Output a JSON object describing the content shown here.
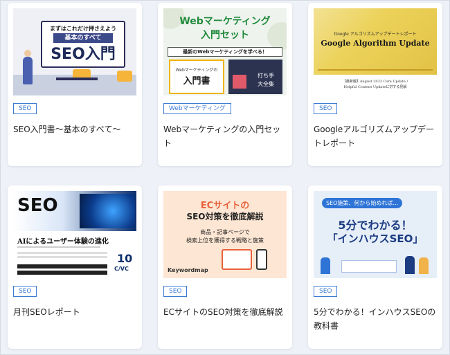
{
  "colors": {
    "tag_blue": "#3a7bd5",
    "page_bg": "#eef1f7",
    "card_bg": "#ffffff"
  },
  "cards": [
    {
      "tag": "SEO",
      "title": "SEO入門書〜基本のすべて〜",
      "thumb": {
        "line1": "まずはこれだけ押さえよう",
        "line2": "基本のすべて",
        "line3": "SEO入門"
      }
    },
    {
      "tag": "Webマーケティング",
      "title": "Webマーケティングの入門セット",
      "thumb": {
        "line1": "Webマーケティング",
        "line2": "入門セット",
        "line3": "最新のWebマーケティングを学べる！",
        "book_a": "入門書",
        "book_a_sub": "Webマーケティングの",
        "book_b": "打ち手",
        "book_b_sub": "大全集"
      }
    },
    {
      "tag": "SEO",
      "title": "Googleアルゴリズムアップデートレポート",
      "thumb": {
        "line1": "Google アルゴリズムアップデートレポート",
        "line2": "Google Algorithm Update",
        "line3": "【最新版】August 2023 Core Update /",
        "line4": "Helpful Content Updateに対する見解"
      }
    },
    {
      "tag": "SEO",
      "title": "月刊SEOレポート",
      "thumb": {
        "line1": "SEO",
        "line2": "AIによるユーザー体験の進化",
        "num": "10",
        "brand": "C/VC"
      }
    },
    {
      "tag": "SEO",
      "title": "ECサイトのSEO対策を徹底解説",
      "thumb": {
        "line1": "ECサイトの",
        "line2": "SEO対策を徹底解説",
        "line3": "商品・記事ページで",
        "line4": "検索上位を獲得する戦略と施策",
        "brand": "Keywordmap"
      }
    },
    {
      "tag": "SEO",
      "title": "5分でわかる！インハウスSEOの教科書",
      "thumb": {
        "line1": "SEO施策、何から始めれば…",
        "line2": "5分でわかる！",
        "line3": "「インハウスSEO」"
      }
    }
  ]
}
